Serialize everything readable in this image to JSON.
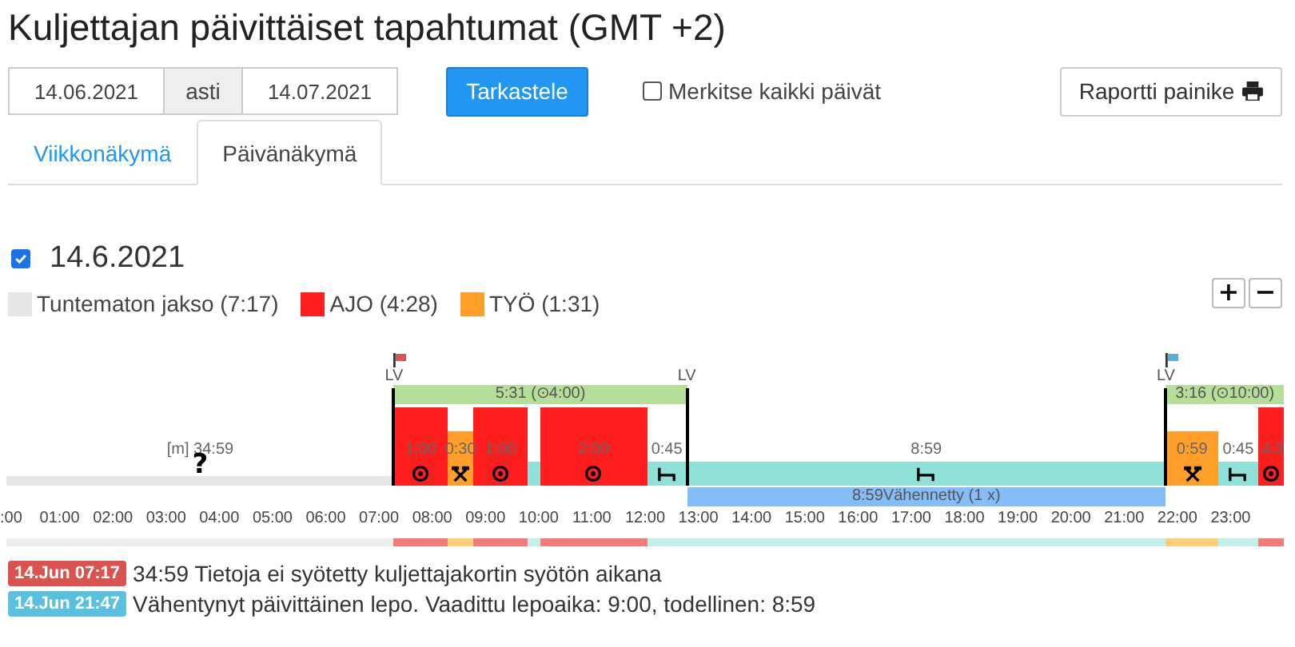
{
  "title": "Kuljettajan päivittäiset tapahtumat (GMT +2)",
  "filter": {
    "from": "14.06.2021",
    "separator": "asti",
    "to": "14.07.2021",
    "view_button": "Tarkastele",
    "mark_all": {
      "label": "Merkitse kaikki päivät",
      "checked": false
    },
    "report_button": "Raportti painike"
  },
  "tabs": [
    {
      "label": "Viikkonäkymä",
      "selected": false
    },
    {
      "label": "Päivänäkymä",
      "selected": true
    }
  ],
  "day": {
    "date": "14.6.2021",
    "checked": true,
    "legend": [
      {
        "label": "Tuntematon jakso (7:17)",
        "color": "#e6e6e6"
      },
      {
        "label": "AJO (4:28)",
        "color": "#ff1e1e"
      },
      {
        "label": "TYÖ (1:31)",
        "color": "#ff9f2a"
      }
    ],
    "zoom_buttons": [
      "+",
      "−"
    ],
    "segments": [
      {
        "kind": "unknown",
        "label": "[m] 34:59",
        "symbol": "?"
      },
      {
        "kind": "drive",
        "label": "1:00"
      },
      {
        "kind": "work",
        "label": "0:30"
      },
      {
        "kind": "drive",
        "label": "1:00"
      },
      {
        "kind": "rest"
      },
      {
        "kind": "drive",
        "label": "2:00"
      },
      {
        "kind": "rest",
        "label": "0:45"
      },
      {
        "kind": "rest",
        "label": "8:59"
      },
      {
        "kind": "work",
        "label": "0:59"
      },
      {
        "kind": "rest",
        "label": "0:45"
      },
      {
        "kind": "drive",
        "label": "4:3"
      }
    ],
    "shifts": [
      {
        "label": "5:31 (⊙4:00)"
      },
      {
        "label": "3:16 (⊙10:00)"
      }
    ],
    "markers": [
      {
        "label": "LV",
        "color": "#e05050"
      },
      {
        "label": "LV"
      },
      {
        "label": "LV",
        "color": "#4fb3d9"
      }
    ],
    "reduced_rest": {
      "label": "8:59Vähennetty (1 x)"
    },
    "hours": [
      ":00",
      "01:00",
      "02:00",
      "03:00",
      "04:00",
      "05:00",
      "06:00",
      "07:00",
      "08:00",
      "09:00",
      "10:00",
      "11:00",
      "12:00",
      "13:00",
      "14:00",
      "15:00",
      "16:00",
      "17:00",
      "18:00",
      "19:00",
      "20:00",
      "21:00",
      "22:00",
      "23:00"
    ]
  },
  "alerts": [
    {
      "time": "14.Jun 07:17",
      "text": "34:59 Tietoja ei syötetty kuljettajakortin syötön aikana",
      "color": "#d9534f"
    },
    {
      "time": "14.Jun 21:47",
      "text": "Vähentynyt päivittäinen lepo. Vaadittu lepoaika: 9:00, todellinen: 8:59",
      "color": "#5bc0de"
    }
  ]
}
